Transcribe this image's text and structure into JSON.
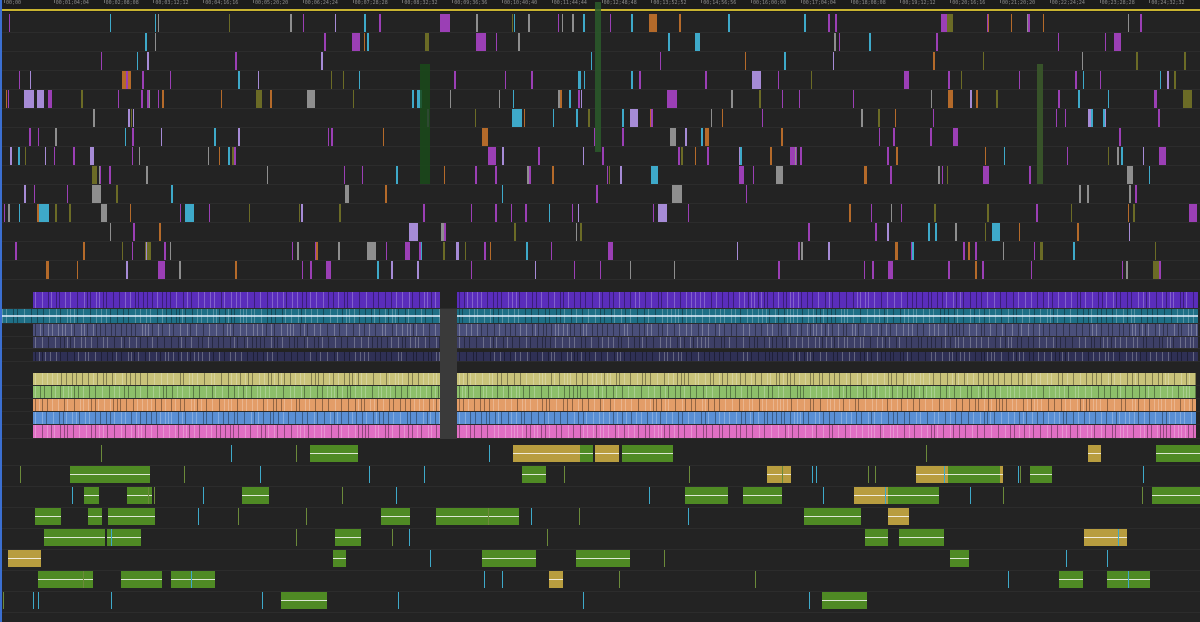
{
  "app": {
    "view": "multitrack timeline"
  },
  "ruler": {
    "timecodes": [
      "00;00",
      "00;01;04;04",
      "00;02;08;08",
      "00;03;12;12",
      "00;04;16;16",
      "00;05;20;20",
      "00;06;24;24",
      "00;07;28;28",
      "00;08;32;32",
      "00;09;36;36",
      "00;10;40;40",
      "00;11;44;44",
      "00;12;48;48",
      "00;13;52;52",
      "00;14;56;56",
      "00;16;00;00",
      "00;17;04;04",
      "00;18;08;08",
      "00;19;12;12",
      "00;20;16;16",
      "00;21;20;20",
      "00;22;24;24",
      "00;23;28;28",
      "00;24;32;32"
    ]
  },
  "colors": {
    "background": "#232323",
    "ruler_bg": "#1c1c1c",
    "ruler_band": "#c9b430",
    "playhead": "#3b6fd1",
    "video_purple": "#5a2dbb",
    "video_teal": "#1f6f86",
    "video_slate": "#4a4f7a",
    "track_yellow": "#c9c37a",
    "track_green": "#8dbf6a",
    "track_orange": "#e39d68",
    "track_blue": "#5a8fd4",
    "track_pink": "#e06fc3",
    "audio_green": "#4f8a24",
    "audio_tan": "#b89d3f",
    "magenta_clip": "#9b3fb5",
    "olive_clip": "#6b6b26",
    "cyan_clip": "#3ea9c9"
  },
  "tracks": {
    "video_upper_count": 14,
    "main_bands": [
      "purple",
      "teal",
      "slate",
      "slate",
      "yellow",
      "green",
      "orange",
      "blue",
      "pink"
    ],
    "audio_lower_count": 8
  }
}
